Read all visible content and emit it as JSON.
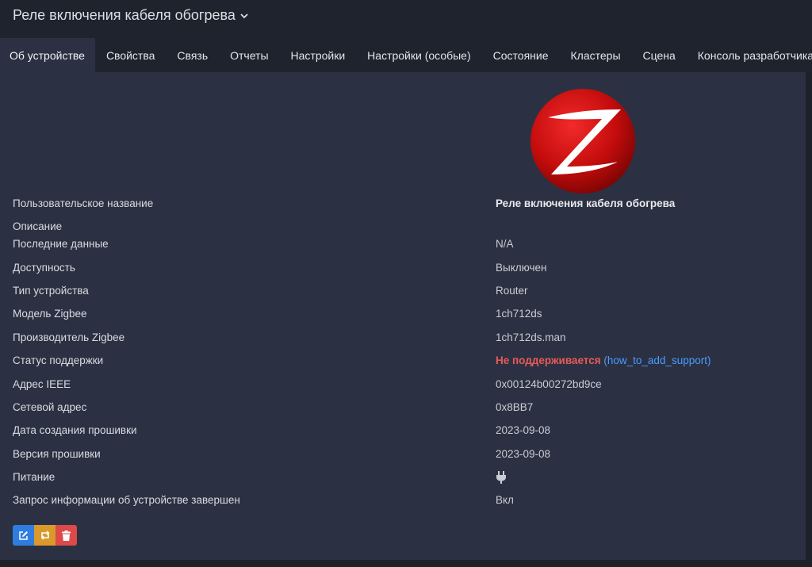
{
  "header": {
    "title": "Реле включения кабеля обогрева"
  },
  "tabs": [
    {
      "label": "Об устройстве",
      "active": true
    },
    {
      "label": "Свойства"
    },
    {
      "label": "Связь"
    },
    {
      "label": "Отчеты"
    },
    {
      "label": "Настройки"
    },
    {
      "label": "Настройки (особые)"
    },
    {
      "label": "Состояние"
    },
    {
      "label": "Кластеры"
    },
    {
      "label": "Сцена"
    },
    {
      "label": "Консоль разработчика"
    }
  ],
  "device": {
    "rows": [
      {
        "label": "Пользовательское название",
        "value": "Реле включения кабеля обогрева"
      },
      {
        "label": "Описание",
        "value": ""
      },
      {
        "label": "Последние данные",
        "value": "N/A"
      },
      {
        "label": "Доступность",
        "value": "Выключен"
      },
      {
        "label": "Тип устройства",
        "value": "Router"
      },
      {
        "label": "Модель Zigbee",
        "value": "1ch712ds"
      },
      {
        "label": "Производитель Zigbee",
        "value": "1ch712ds.man"
      },
      {
        "label": "Статус поддержки",
        "value": "Не поддерживается",
        "link": "(how_to_add_support)"
      },
      {
        "label": "Адрес IEEE",
        "value": "0x00124b00272bd9ce"
      },
      {
        "label": "Сетевой адрес",
        "value": "0x8BB7"
      },
      {
        "label": "Дата создания прошивки",
        "value": "2023-09-08"
      },
      {
        "label": "Версия прошивки",
        "value": "2023-09-08"
      },
      {
        "label": "Питание",
        "value": "",
        "icon": "plug-icon"
      },
      {
        "label": "Запрос информации об устройстве завершен",
        "value": "Вкл"
      }
    ]
  },
  "colors": {
    "panel": "#2b3142",
    "link": "#4a9bff",
    "danger": "#e85a5a",
    "edit": "#2f7de1",
    "swap": "#d99a2b",
    "delete": "#dc4a4a"
  },
  "icons": {
    "logo": "zigbee-logo",
    "edit": "edit-icon",
    "swap": "swap-icon",
    "delete": "trash-icon"
  }
}
